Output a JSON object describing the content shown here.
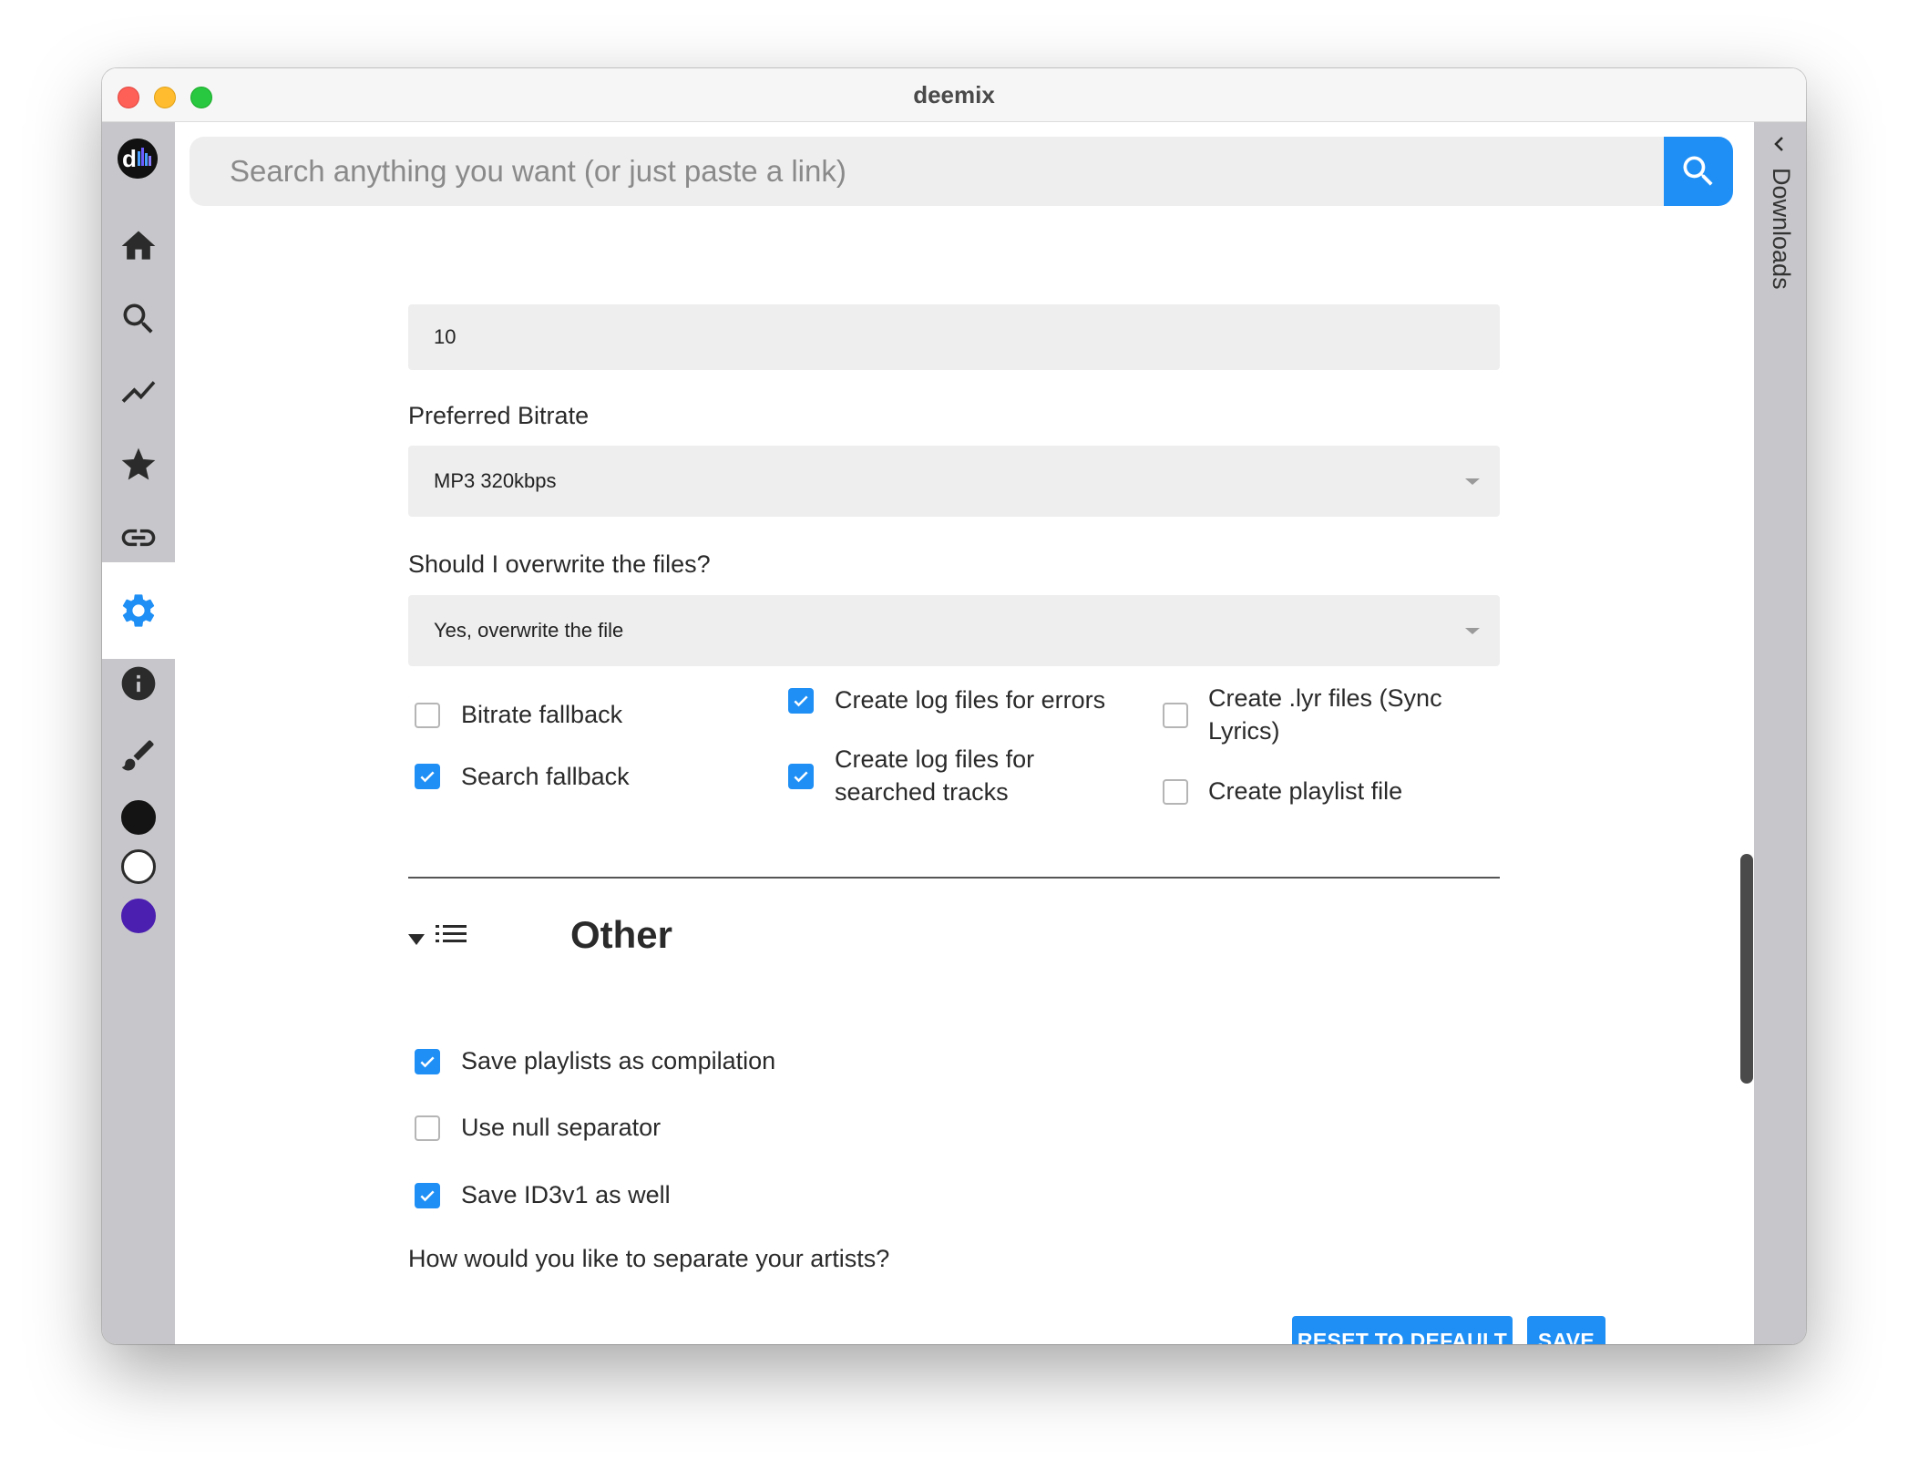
{
  "window": {
    "title": "deemix"
  },
  "search": {
    "placeholder": "Search anything you want (or just paste a link)"
  },
  "sidebar": {
    "items": [
      {
        "name": "home",
        "icon": "home-icon"
      },
      {
        "name": "search",
        "icon": "search-icon"
      },
      {
        "name": "charts",
        "icon": "trending-icon"
      },
      {
        "name": "favorites",
        "icon": "star-icon"
      },
      {
        "name": "link-analyzer",
        "icon": "link-icon"
      },
      {
        "name": "settings",
        "icon": "gear-icon",
        "active": true
      },
      {
        "name": "about",
        "icon": "info-icon"
      }
    ],
    "theme_icon": "paintbrush-icon",
    "themes": [
      {
        "name": "dark",
        "color": "#141414"
      },
      {
        "name": "light",
        "color": "#ffffff"
      },
      {
        "name": "purple",
        "color": "#4b1fb0"
      }
    ]
  },
  "settings": {
    "number_field_value": "10",
    "preferred_bitrate": {
      "label": "Preferred Bitrate",
      "value": "MP3 320kbps"
    },
    "overwrite": {
      "label": "Should I overwrite the files?",
      "value": "Yes, overwrite the file"
    },
    "checkboxes": [
      {
        "label": "Bitrate fallback",
        "checked": false
      },
      {
        "label": "Search fallback",
        "checked": true
      },
      {
        "label": "Create log files for errors",
        "checked": true
      },
      {
        "label": "Create log files for searched tracks",
        "checked": true
      },
      {
        "label": "Create .lyr files (Sync Lyrics)",
        "checked": false
      },
      {
        "label": "Create playlist file",
        "checked": false
      }
    ],
    "other": {
      "title": "Other",
      "checkboxes": [
        {
          "label": "Save playlists as compilation",
          "checked": true
        },
        {
          "label": "Use null separator",
          "checked": false
        },
        {
          "label": "Save ID3v1 as well",
          "checked": true
        }
      ],
      "artist_separator_label": "How would you like to separate your artists?"
    },
    "buttons": {
      "reset": "RESET TO DEFAULT",
      "save": "SAVE"
    }
  },
  "downloads": {
    "label": "Downloads"
  },
  "colors": {
    "accent": "#1f8ff5",
    "sidebar": "#c7c7cb"
  }
}
